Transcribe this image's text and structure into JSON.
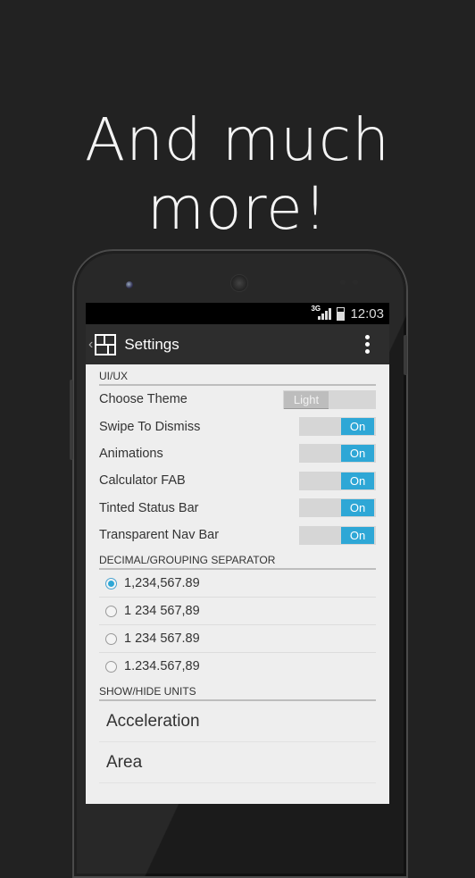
{
  "headline": "And much more!",
  "status_bar": {
    "network": "3G",
    "time": "12:03"
  },
  "action_bar": {
    "title": "Settings"
  },
  "sections": {
    "uiux": {
      "title": "UI/UX",
      "theme": {
        "label": "Choose Theme",
        "value": "Light"
      },
      "toggles": [
        {
          "label": "Swipe To Dismiss",
          "value": "On"
        },
        {
          "label": "Animations",
          "value": "On"
        },
        {
          "label": "Calculator FAB",
          "value": "On"
        },
        {
          "label": "Tinted Status Bar",
          "value": "On"
        },
        {
          "label": "Transparent Nav Bar",
          "value": "On"
        }
      ]
    },
    "separator": {
      "title": "DECIMAL/GROUPING SEPARATOR",
      "options": [
        {
          "label": "1,234,567.89",
          "checked": true
        },
        {
          "label": "1 234 567,89",
          "checked": false
        },
        {
          "label": "1 234 567.89",
          "checked": false
        },
        {
          "label": "1.234.567,89",
          "checked": false
        }
      ]
    },
    "units": {
      "title": "SHOW/HIDE UNITS",
      "items": [
        "Acceleration",
        "Area"
      ]
    }
  },
  "colors": {
    "accent": "#2ea7d6",
    "actionbar": "#2d2d2d",
    "background": "#222222"
  }
}
